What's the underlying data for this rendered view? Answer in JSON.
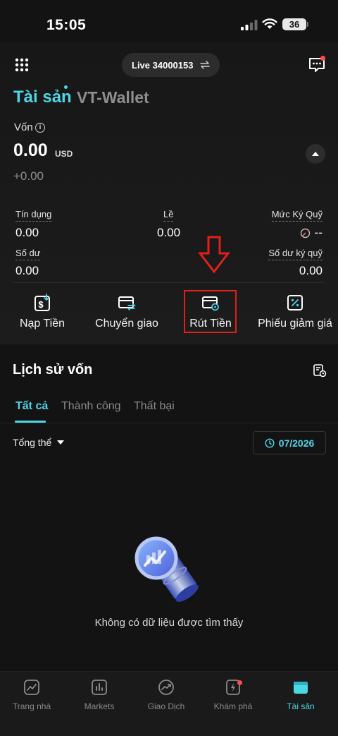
{
  "status_bar": {
    "time": "15:05",
    "battery": "36"
  },
  "header": {
    "account_label": "Live 34000153"
  },
  "titles": {
    "assets": "Tài sản",
    "wallet": "VT-Wallet"
  },
  "capital": {
    "label": "Vốn",
    "value": "0.00",
    "currency": "USD",
    "pnl": "+0.00"
  },
  "stats": {
    "credit": {
      "label": "Tín dụng",
      "value": "0.00"
    },
    "fee": {
      "label": "Lề",
      "value": "0.00"
    },
    "margin_level": {
      "label": "Mức Ký Quỹ",
      "value": "--"
    },
    "balance": {
      "label": "Số dư",
      "value": "0.00"
    },
    "margin_balance": {
      "label": "Số dư ký quỹ",
      "value": "0.00"
    }
  },
  "actions": [
    {
      "label": "Nạp Tiền",
      "icon": "deposit-icon"
    },
    {
      "label": "Chuyển giao",
      "icon": "transfer-icon"
    },
    {
      "label": "Rút Tiền",
      "icon": "withdraw-icon"
    },
    {
      "label": "Phiếu giảm giá",
      "icon": "coupon-icon"
    }
  ],
  "history": {
    "title": "Lịch sử vốn",
    "tabs": [
      "Tất cả",
      "Thành công",
      "Thất bại"
    ],
    "filter": "Tổng thể",
    "date": "07/2026",
    "empty_message": "Không có dữ liệu được tìm thấy"
  },
  "nav": [
    {
      "label": "Trang nhà",
      "icon": "home-chart-icon"
    },
    {
      "label": "Markets",
      "icon": "markets-icon"
    },
    {
      "label": "Giao Dịch",
      "icon": "trade-icon"
    },
    {
      "label": "Khám phá",
      "icon": "explore-icon"
    },
    {
      "label": "Tài sản",
      "icon": "wallet-icon"
    }
  ],
  "colors": {
    "accent": "#4dd6e6",
    "highlight": "#e0201b",
    "background": "#131313"
  }
}
